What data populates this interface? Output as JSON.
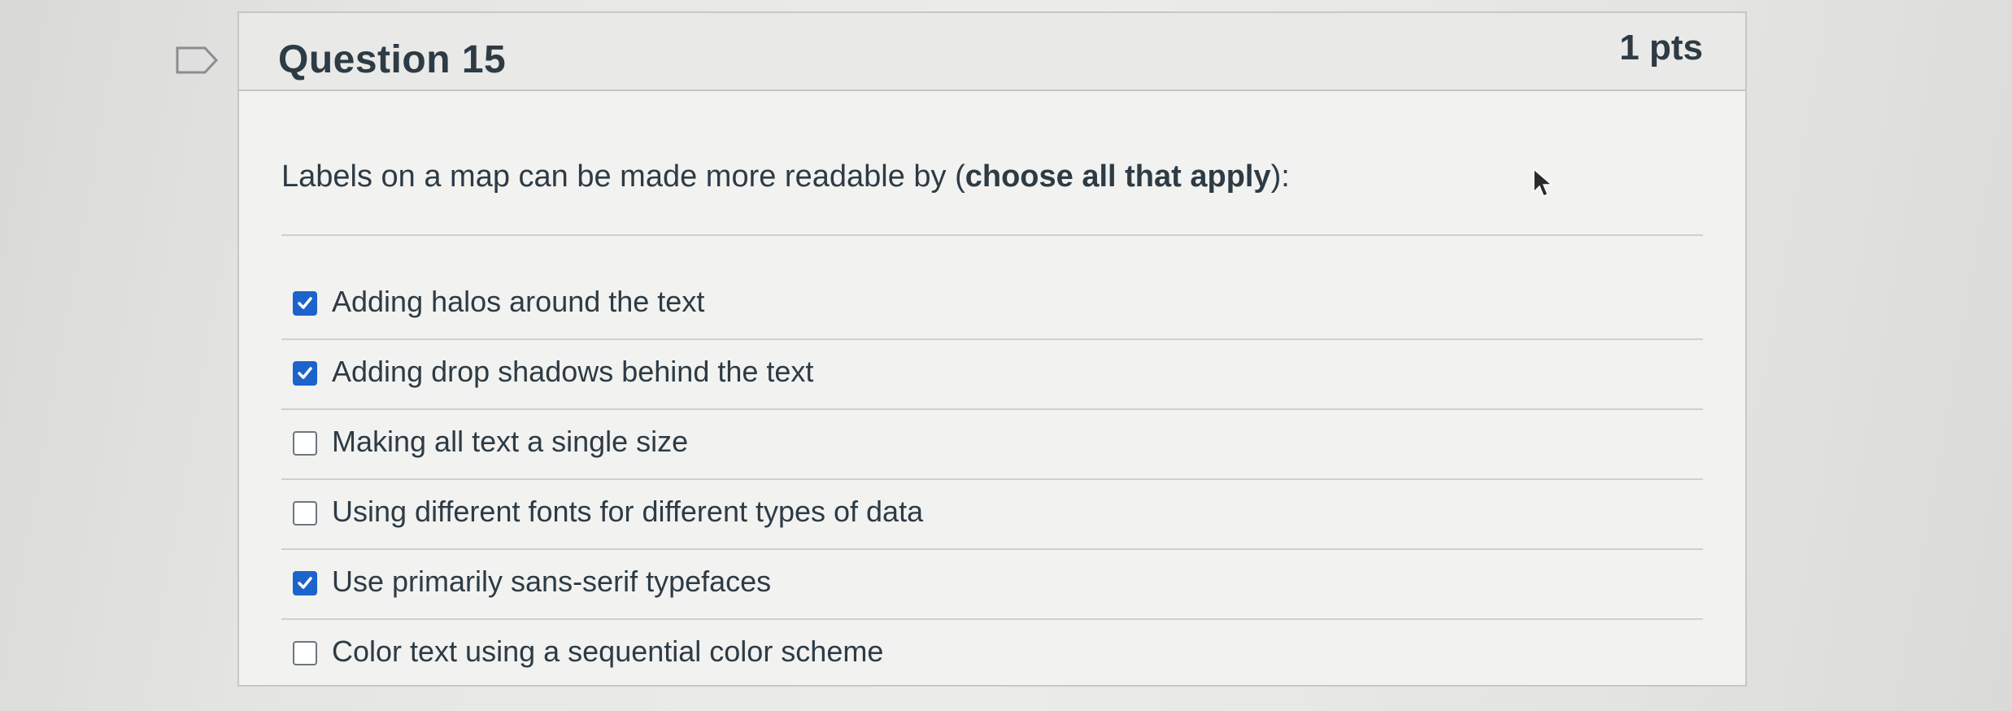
{
  "question": {
    "title": "Question 15",
    "points": "1 pts",
    "prompt_start": "Labels on a map can be made more readable by (",
    "prompt_bold": "choose all that apply",
    "prompt_end": "):"
  },
  "answers": [
    {
      "label": "Adding halos around the text",
      "checked": true
    },
    {
      "label": "Adding drop shadows behind the text",
      "checked": true
    },
    {
      "label": "Making all text a single size",
      "checked": false
    },
    {
      "label": "Using different fonts for different types of data",
      "checked": false
    },
    {
      "label": "Use primarily sans-serif typefaces",
      "checked": true
    },
    {
      "label": "Color text using a sequential color scheme",
      "checked": false
    }
  ],
  "colors": {
    "checkbox_checked": "#1c63cc",
    "text": "#2d3b45"
  },
  "icons": {
    "flag": "flag-icon",
    "cursor": "cursor-icon",
    "check": "check-icon"
  }
}
